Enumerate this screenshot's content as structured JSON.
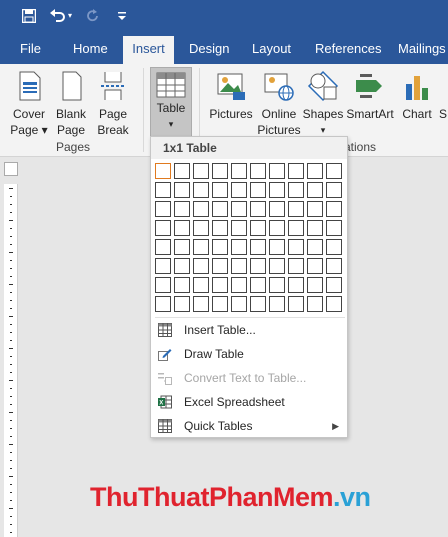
{
  "tabs": [
    "File",
    "Home",
    "Insert",
    "Design",
    "Layout",
    "References",
    "Mailings"
  ],
  "ribbon": {
    "pages": [
      {
        "line1": "Cover",
        "line2": "Page ▾"
      },
      {
        "line1": "Blank",
        "line2": "Page"
      },
      {
        "line1": "Page",
        "line2": "Break"
      }
    ],
    "pages_group": "Pages",
    "table": {
      "label": "Table",
      "arrow": "▾"
    },
    "illustrations": [
      {
        "line1": "Pictures",
        "line2": ""
      },
      {
        "line1": "Online",
        "line2": "Pictures"
      },
      {
        "line1": "Shapes",
        "line2": "▾"
      },
      {
        "line1": "SmartArt",
        "line2": ""
      },
      {
        "line1": "Chart",
        "line2": ""
      },
      {
        "line1": "S",
        "line2": ""
      }
    ],
    "illustrations_group": "rations"
  },
  "dropdown": {
    "title": "1x1 Table",
    "grid_cols": 10,
    "grid_rows": 8,
    "items": [
      {
        "label": "Insert Table...",
        "icon": "table-icon",
        "disabled": false
      },
      {
        "label": "Draw Table",
        "icon": "pencil-icon",
        "disabled": false
      },
      {
        "label": "Convert Text to Table...",
        "icon": "convert-icon",
        "disabled": true
      },
      {
        "label": "Excel Spreadsheet",
        "icon": "excel-icon",
        "disabled": false
      },
      {
        "label": "Quick Tables",
        "icon": "table-icon",
        "disabled": false,
        "arrow": "▶"
      }
    ]
  },
  "watermark": {
    "part1": "ThuThuat",
    "part2": "PhanMem",
    "part3": ".vn"
  }
}
